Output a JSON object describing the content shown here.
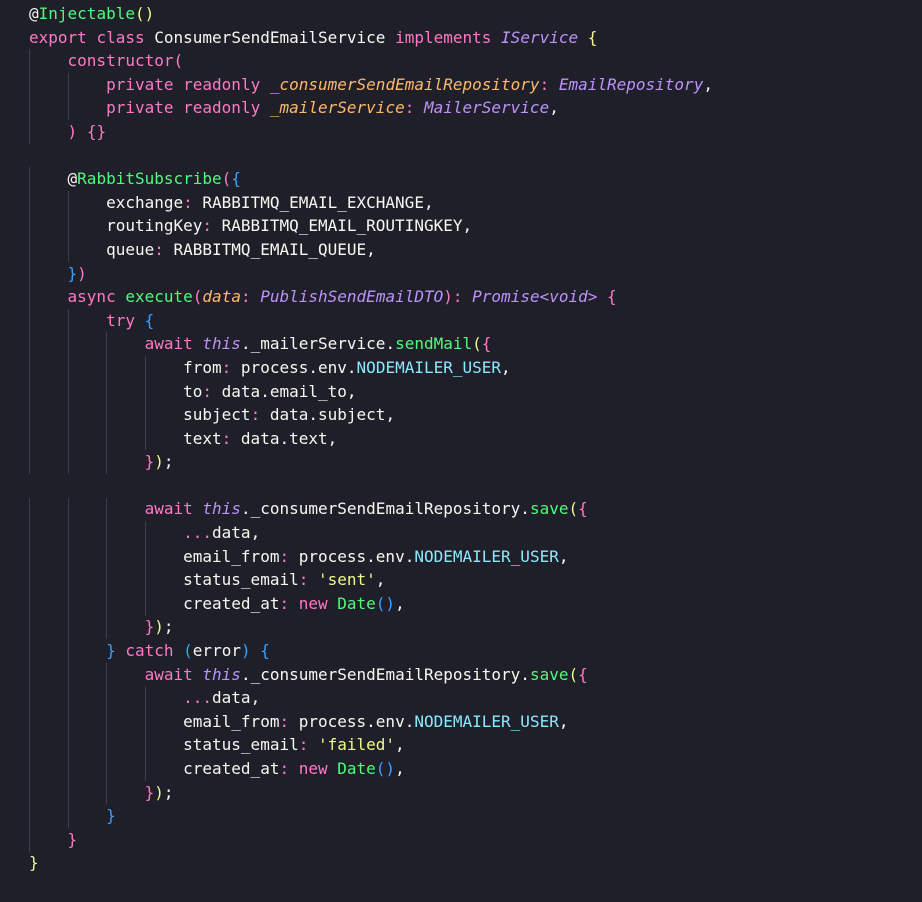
{
  "editor": {
    "background": "#1e1f29",
    "lines": [
      [
        {
          "t": "@",
          "c": "t-plain"
        },
        {
          "t": "Injectable",
          "c": "t-deco"
        },
        {
          "t": "()",
          "c": "t-br1"
        }
      ],
      [
        {
          "t": "export",
          "c": "t-kw"
        },
        {
          "t": " ",
          "c": "t-plain"
        },
        {
          "t": "class",
          "c": "t-kw"
        },
        {
          "t": " ",
          "c": "t-plain"
        },
        {
          "t": "ConsumerSendEmailService",
          "c": "t-cls"
        },
        {
          "t": " ",
          "c": "t-plain"
        },
        {
          "t": "implements",
          "c": "t-kw"
        },
        {
          "t": " ",
          "c": "t-plain"
        },
        {
          "t": "IService",
          "c": "t-type"
        },
        {
          "t": " ",
          "c": "t-plain"
        },
        {
          "t": "{",
          "c": "t-br1"
        }
      ],
      [
        {
          "t": "    ",
          "c": "t-plain"
        },
        {
          "t": "constructor",
          "c": "t-kw"
        },
        {
          "t": "(",
          "c": "t-br2"
        }
      ],
      [
        {
          "t": "        ",
          "c": "t-plain"
        },
        {
          "t": "private",
          "c": "t-kw"
        },
        {
          "t": " ",
          "c": "t-plain"
        },
        {
          "t": "readonly",
          "c": "t-kw"
        },
        {
          "t": " ",
          "c": "t-plain"
        },
        {
          "t": "_consumerSendEmailRepository",
          "c": "t-param"
        },
        {
          "t": ": ",
          "c": "t-kw"
        },
        {
          "t": "EmailRepository",
          "c": "t-type"
        },
        {
          "t": ",",
          "c": "t-plain"
        }
      ],
      [
        {
          "t": "        ",
          "c": "t-plain"
        },
        {
          "t": "private",
          "c": "t-kw"
        },
        {
          "t": " ",
          "c": "t-plain"
        },
        {
          "t": "readonly",
          "c": "t-kw"
        },
        {
          "t": " ",
          "c": "t-plain"
        },
        {
          "t": "_mailerService",
          "c": "t-param"
        },
        {
          "t": ": ",
          "c": "t-kw"
        },
        {
          "t": "MailerService",
          "c": "t-type"
        },
        {
          "t": ",",
          "c": "t-plain"
        }
      ],
      [
        {
          "t": "    ",
          "c": "t-plain"
        },
        {
          "t": ")",
          "c": "t-br2"
        },
        {
          "t": " ",
          "c": "t-plain"
        },
        {
          "t": "{}",
          "c": "t-br2"
        }
      ],
      [
        {
          "t": "",
          "c": "t-plain"
        }
      ],
      [
        {
          "t": "    ",
          "c": "t-plain"
        },
        {
          "t": "@",
          "c": "t-plain"
        },
        {
          "t": "RabbitSubscribe",
          "c": "t-deco"
        },
        {
          "t": "(",
          "c": "t-br2"
        },
        {
          "t": "{",
          "c": "t-br3"
        }
      ],
      [
        {
          "t": "        ",
          "c": "t-plain"
        },
        {
          "t": "exchange",
          "c": "t-plain"
        },
        {
          "t": ": ",
          "c": "t-kw"
        },
        {
          "t": "RABBITMQ_EMAIL_EXCHANGE",
          "c": "t-plain"
        },
        {
          "t": ",",
          "c": "t-plain"
        }
      ],
      [
        {
          "t": "        ",
          "c": "t-plain"
        },
        {
          "t": "routingKey",
          "c": "t-plain"
        },
        {
          "t": ": ",
          "c": "t-kw"
        },
        {
          "t": "RABBITMQ_EMAIL_ROUTINGKEY",
          "c": "t-plain"
        },
        {
          "t": ",",
          "c": "t-plain"
        }
      ],
      [
        {
          "t": "        ",
          "c": "t-plain"
        },
        {
          "t": "queue",
          "c": "t-plain"
        },
        {
          "t": ": ",
          "c": "t-kw"
        },
        {
          "t": "RABBITMQ_EMAIL_QUEUE",
          "c": "t-plain"
        },
        {
          "t": ",",
          "c": "t-plain"
        }
      ],
      [
        {
          "t": "    ",
          "c": "t-plain"
        },
        {
          "t": "}",
          "c": "t-br3"
        },
        {
          "t": ")",
          "c": "t-br2"
        }
      ],
      [
        {
          "t": "    ",
          "c": "t-plain"
        },
        {
          "t": "async",
          "c": "t-kw"
        },
        {
          "t": " ",
          "c": "t-plain"
        },
        {
          "t": "execute",
          "c": "t-fn"
        },
        {
          "t": "(",
          "c": "t-br2"
        },
        {
          "t": "data",
          "c": "t-param"
        },
        {
          "t": ": ",
          "c": "t-kw"
        },
        {
          "t": "PublishSendEmailDTO",
          "c": "t-type"
        },
        {
          "t": ")",
          "c": "t-br2"
        },
        {
          "t": ": ",
          "c": "t-kw"
        },
        {
          "t": "Promise",
          "c": "t-type"
        },
        {
          "t": "<",
          "c": "t-type"
        },
        {
          "t": "void",
          "c": "t-type"
        },
        {
          "t": ">",
          "c": "t-type"
        },
        {
          "t": " ",
          "c": "t-plain"
        },
        {
          "t": "{",
          "c": "t-br2"
        }
      ],
      [
        {
          "t": "        ",
          "c": "t-plain"
        },
        {
          "t": "try",
          "c": "t-kw"
        },
        {
          "t": " ",
          "c": "t-plain"
        },
        {
          "t": "{",
          "c": "t-br3"
        }
      ],
      [
        {
          "t": "            ",
          "c": "t-plain"
        },
        {
          "t": "await",
          "c": "t-kw"
        },
        {
          "t": " ",
          "c": "t-plain"
        },
        {
          "t": "this",
          "c": "t-this"
        },
        {
          "t": ".",
          "c": "t-plain"
        },
        {
          "t": "_mailerService",
          "c": "t-plain"
        },
        {
          "t": ".",
          "c": "t-plain"
        },
        {
          "t": "sendMail",
          "c": "t-fn"
        },
        {
          "t": "(",
          "c": "t-br1"
        },
        {
          "t": "{",
          "c": "t-br2"
        }
      ],
      [
        {
          "t": "                ",
          "c": "t-plain"
        },
        {
          "t": "from",
          "c": "t-plain"
        },
        {
          "t": ": ",
          "c": "t-kw"
        },
        {
          "t": "process",
          "c": "t-plain"
        },
        {
          "t": ".",
          "c": "t-plain"
        },
        {
          "t": "env",
          "c": "t-plain"
        },
        {
          "t": ".",
          "c": "t-plain"
        },
        {
          "t": "NODEMAILER_USER",
          "c": "t-const"
        },
        {
          "t": ",",
          "c": "t-plain"
        }
      ],
      [
        {
          "t": "                ",
          "c": "t-plain"
        },
        {
          "t": "to",
          "c": "t-plain"
        },
        {
          "t": ": ",
          "c": "t-kw"
        },
        {
          "t": "data",
          "c": "t-plain"
        },
        {
          "t": ".",
          "c": "t-plain"
        },
        {
          "t": "email_to",
          "c": "t-plain"
        },
        {
          "t": ",",
          "c": "t-plain"
        }
      ],
      [
        {
          "t": "                ",
          "c": "t-plain"
        },
        {
          "t": "subject",
          "c": "t-plain"
        },
        {
          "t": ": ",
          "c": "t-kw"
        },
        {
          "t": "data",
          "c": "t-plain"
        },
        {
          "t": ".",
          "c": "t-plain"
        },
        {
          "t": "subject",
          "c": "t-plain"
        },
        {
          "t": ",",
          "c": "t-plain"
        }
      ],
      [
        {
          "t": "                ",
          "c": "t-plain"
        },
        {
          "t": "text",
          "c": "t-plain"
        },
        {
          "t": ": ",
          "c": "t-kw"
        },
        {
          "t": "data",
          "c": "t-plain"
        },
        {
          "t": ".",
          "c": "t-plain"
        },
        {
          "t": "text",
          "c": "t-plain"
        },
        {
          "t": ",",
          "c": "t-plain"
        }
      ],
      [
        {
          "t": "            ",
          "c": "t-plain"
        },
        {
          "t": "}",
          "c": "t-br2"
        },
        {
          "t": ")",
          "c": "t-br1"
        },
        {
          "t": ";",
          "c": "t-plain"
        }
      ],
      [
        {
          "t": "",
          "c": "t-plain"
        }
      ],
      [
        {
          "t": "            ",
          "c": "t-plain"
        },
        {
          "t": "await",
          "c": "t-kw"
        },
        {
          "t": " ",
          "c": "t-plain"
        },
        {
          "t": "this",
          "c": "t-this"
        },
        {
          "t": ".",
          "c": "t-plain"
        },
        {
          "t": "_consumerSendEmailRepository",
          "c": "t-plain"
        },
        {
          "t": ".",
          "c": "t-plain"
        },
        {
          "t": "save",
          "c": "t-fn"
        },
        {
          "t": "(",
          "c": "t-br1"
        },
        {
          "t": "{",
          "c": "t-br2"
        }
      ],
      [
        {
          "t": "                ",
          "c": "t-plain"
        },
        {
          "t": "...",
          "c": "t-kw"
        },
        {
          "t": "data",
          "c": "t-plain"
        },
        {
          "t": ",",
          "c": "t-plain"
        }
      ],
      [
        {
          "t": "                ",
          "c": "t-plain"
        },
        {
          "t": "email_from",
          "c": "t-plain"
        },
        {
          "t": ": ",
          "c": "t-kw"
        },
        {
          "t": "process",
          "c": "t-plain"
        },
        {
          "t": ".",
          "c": "t-plain"
        },
        {
          "t": "env",
          "c": "t-plain"
        },
        {
          "t": ".",
          "c": "t-plain"
        },
        {
          "t": "NODEMAILER_USER",
          "c": "t-const"
        },
        {
          "t": ",",
          "c": "t-plain"
        }
      ],
      [
        {
          "t": "                ",
          "c": "t-plain"
        },
        {
          "t": "status_email",
          "c": "t-plain"
        },
        {
          "t": ": ",
          "c": "t-kw"
        },
        {
          "t": "'sent'",
          "c": "t-str"
        },
        {
          "t": ",",
          "c": "t-plain"
        }
      ],
      [
        {
          "t": "                ",
          "c": "t-plain"
        },
        {
          "t": "created_at",
          "c": "t-plain"
        },
        {
          "t": ": ",
          "c": "t-kw"
        },
        {
          "t": "new",
          "c": "t-kw"
        },
        {
          "t": " ",
          "c": "t-plain"
        },
        {
          "t": "Date",
          "c": "t-fn"
        },
        {
          "t": "()",
          "c": "t-br3"
        },
        {
          "t": ",",
          "c": "t-plain"
        }
      ],
      [
        {
          "t": "            ",
          "c": "t-plain"
        },
        {
          "t": "}",
          "c": "t-br2"
        },
        {
          "t": ")",
          "c": "t-br1"
        },
        {
          "t": ";",
          "c": "t-plain"
        }
      ],
      [
        {
          "t": "        ",
          "c": "t-plain"
        },
        {
          "t": "}",
          "c": "t-br3"
        },
        {
          "t": " ",
          "c": "t-plain"
        },
        {
          "t": "catch",
          "c": "t-kw"
        },
        {
          "t": " ",
          "c": "t-plain"
        },
        {
          "t": "(",
          "c": "t-br3"
        },
        {
          "t": "error",
          "c": "t-plain"
        },
        {
          "t": ")",
          "c": "t-br3"
        },
        {
          "t": " ",
          "c": "t-plain"
        },
        {
          "t": "{",
          "c": "t-br3"
        }
      ],
      [
        {
          "t": "            ",
          "c": "t-plain"
        },
        {
          "t": "await",
          "c": "t-kw"
        },
        {
          "t": " ",
          "c": "t-plain"
        },
        {
          "t": "this",
          "c": "t-this"
        },
        {
          "t": ".",
          "c": "t-plain"
        },
        {
          "t": "_consumerSendEmailRepository",
          "c": "t-plain"
        },
        {
          "t": ".",
          "c": "t-plain"
        },
        {
          "t": "save",
          "c": "t-fn"
        },
        {
          "t": "(",
          "c": "t-br1"
        },
        {
          "t": "{",
          "c": "t-br2"
        }
      ],
      [
        {
          "t": "                ",
          "c": "t-plain"
        },
        {
          "t": "...",
          "c": "t-kw"
        },
        {
          "t": "data",
          "c": "t-plain"
        },
        {
          "t": ",",
          "c": "t-plain"
        }
      ],
      [
        {
          "t": "                ",
          "c": "t-plain"
        },
        {
          "t": "email_from",
          "c": "t-plain"
        },
        {
          "t": ": ",
          "c": "t-kw"
        },
        {
          "t": "process",
          "c": "t-plain"
        },
        {
          "t": ".",
          "c": "t-plain"
        },
        {
          "t": "env",
          "c": "t-plain"
        },
        {
          "t": ".",
          "c": "t-plain"
        },
        {
          "t": "NODEMAILER_USER",
          "c": "t-const"
        },
        {
          "t": ",",
          "c": "t-plain"
        }
      ],
      [
        {
          "t": "                ",
          "c": "t-plain"
        },
        {
          "t": "status_email",
          "c": "t-plain"
        },
        {
          "t": ": ",
          "c": "t-kw"
        },
        {
          "t": "'failed'",
          "c": "t-str"
        },
        {
          "t": ",",
          "c": "t-plain"
        }
      ],
      [
        {
          "t": "                ",
          "c": "t-plain"
        },
        {
          "t": "created_at",
          "c": "t-plain"
        },
        {
          "t": ": ",
          "c": "t-kw"
        },
        {
          "t": "new",
          "c": "t-kw"
        },
        {
          "t": " ",
          "c": "t-plain"
        },
        {
          "t": "Date",
          "c": "t-fn"
        },
        {
          "t": "()",
          "c": "t-br3"
        },
        {
          "t": ",",
          "c": "t-plain"
        }
      ],
      [
        {
          "t": "            ",
          "c": "t-plain"
        },
        {
          "t": "}",
          "c": "t-br2"
        },
        {
          "t": ")",
          "c": "t-br1"
        },
        {
          "t": ";",
          "c": "t-plain"
        }
      ],
      [
        {
          "t": "        ",
          "c": "t-plain"
        },
        {
          "t": "}",
          "c": "t-br3"
        }
      ],
      [
        {
          "t": "    ",
          "c": "t-plain"
        },
        {
          "t": "}",
          "c": "t-br2"
        }
      ],
      [
        {
          "t": "}",
          "c": "t-br1"
        }
      ]
    ]
  }
}
